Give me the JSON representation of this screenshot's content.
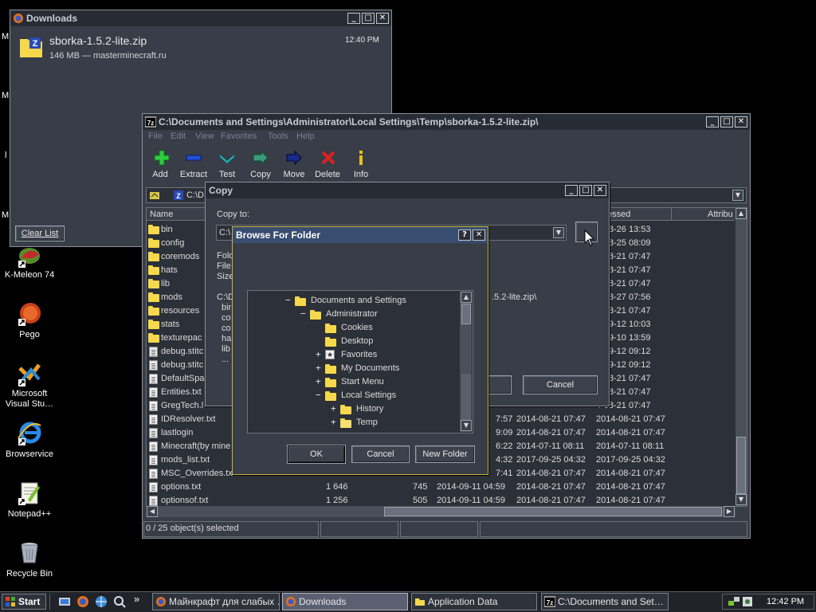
{
  "desktop": {
    "icons": [
      {
        "label": "K-Meleon 74",
        "icon": "k-meleon-icon"
      },
      {
        "label": "Pego",
        "icon": "pego-icon"
      },
      {
        "label": "Microsoft Visual Stu…",
        "icon": "visual-studio-icon"
      },
      {
        "label": "Browservice",
        "icon": "internet-explorer-icon"
      },
      {
        "label": "Notepad++",
        "icon": "notepad-plus-plus-icon"
      },
      {
        "label": "Recycle Bin",
        "icon": "recycle-bin-icon"
      }
    ],
    "partial_labels": [
      "M",
      "M",
      "l",
      "M"
    ]
  },
  "downloads": {
    "title": "Downloads",
    "item": {
      "name": "sborka-1.5.2-lite.zip",
      "info": "146 MB — masterminecraft.ru",
      "time": "12:40 PM"
    },
    "clear_list": "Clear List"
  },
  "sevenzip": {
    "title": "C:\\Documents and Settings\\Administrator\\Local Settings\\Temp\\sborka-1.5.2-lite.zip\\",
    "menu": [
      "File",
      "Edit",
      "View",
      "Favorites",
      "Tools",
      "Help"
    ],
    "toolbar": [
      {
        "label": "Add",
        "icon": "add-plus-icon",
        "color": "#2ecc40"
      },
      {
        "label": "Extract",
        "icon": "extract-minus-icon",
        "color": "#2050d8"
      },
      {
        "label": "Test",
        "icon": "test-check-icon",
        "color": "#38c8d0"
      },
      {
        "label": "Copy",
        "icon": "copy-arrow-icon",
        "color": "#3a9a7a"
      },
      {
        "label": "Move",
        "icon": "move-arrow-icon",
        "color": "#1a2a8a"
      },
      {
        "label": "Delete",
        "icon": "delete-x-icon",
        "color": "#e02020"
      },
      {
        "label": "Info",
        "icon": "info-icon",
        "color": "#e8c020"
      }
    ],
    "address": "C:\\D",
    "columns": {
      "name": "Name",
      "accessed": "essed",
      "attributes": "Attribu"
    },
    "rows": [
      {
        "name": "bin",
        "type": "folder",
        "size": "",
        "packed": "",
        "modified": "",
        "created": "",
        "accessed": "4-08-26 13:53"
      },
      {
        "name": "config",
        "type": "folder",
        "size": "",
        "packed": "",
        "modified": "",
        "created": "",
        "accessed": "4-08-25 08:09"
      },
      {
        "name": "coremods",
        "type": "folder",
        "size": "",
        "packed": "",
        "modified": "",
        "created": "",
        "accessed": "4-08-21 07:47"
      },
      {
        "name": "hats",
        "type": "folder",
        "size": "",
        "packed": "",
        "modified": "",
        "created": "",
        "accessed": "4-08-21 07:47"
      },
      {
        "name": "lib",
        "type": "folder",
        "size": "",
        "packed": "",
        "modified": "",
        "created": "",
        "accessed": "4-08-21 07:47"
      },
      {
        "name": "mods",
        "type": "folder",
        "size": "",
        "packed": "",
        "modified": "",
        "created": "",
        "accessed": "4-08-27 07:56"
      },
      {
        "name": "resources",
        "type": "folder",
        "size": "",
        "packed": "",
        "modified": "",
        "created": "",
        "accessed": "4-08-21 07:47"
      },
      {
        "name": "stats",
        "type": "folder",
        "size": "",
        "packed": "",
        "modified": "",
        "created": "",
        "accessed": "4-09-12 10:03"
      },
      {
        "name": "texturepac",
        "type": "folder",
        "size": "",
        "packed": "",
        "modified": "",
        "created": "",
        "accessed": "4-09-10 13:59"
      },
      {
        "name": "debug.stitc",
        "type": "image",
        "size": "",
        "packed": "",
        "modified": "",
        "created": "",
        "accessed": "4-09-12 09:12"
      },
      {
        "name": "debug.stitc",
        "type": "image",
        "size": "",
        "packed": "",
        "modified": "",
        "created": "",
        "accessed": "4-09-12 09:12"
      },
      {
        "name": "DefaultSpa",
        "type": "file",
        "size": "",
        "packed": "",
        "modified": "",
        "created": "",
        "accessed": "4-08-21 07:47"
      },
      {
        "name": "Entities.txt",
        "type": "file",
        "size": "",
        "packed": "",
        "modified": "",
        "created": "",
        "accessed": "4-08-21 07:47"
      },
      {
        "name": "GregTech.l",
        "type": "file",
        "size": "",
        "packed": "",
        "modified": "",
        "created": "",
        "accessed": "4-08-21 07:47"
      },
      {
        "name": "IDResolver.txt",
        "type": "file",
        "size": "",
        "packed": "",
        "modified": "7:57",
        "created": "2014-08-21 07:47",
        "accessed": "2014-08-21 07:47"
      },
      {
        "name": "lastlogin",
        "type": "image",
        "size": "",
        "packed": "",
        "modified": "9:09",
        "created": "2014-08-21 07:47",
        "accessed": "2014-08-21 07:47"
      },
      {
        "name": "Minecraft(by mine",
        "type": "file",
        "size": "",
        "packed": "",
        "modified": "6:22",
        "created": "2014-07-11 08:11",
        "accessed": "2014-07-11 08:11"
      },
      {
        "name": "mods_list.txt",
        "type": "file",
        "size": "",
        "packed": "",
        "modified": "4:32",
        "created": "2017-09-25 04:32",
        "accessed": "2017-09-25 04:32"
      },
      {
        "name": "MSC_Overrides.txt",
        "type": "file",
        "size": "",
        "packed": "",
        "modified": "7:41",
        "created": "2014-08-21 07:47",
        "accessed": "2014-08-21 07:47"
      },
      {
        "name": "options.txt",
        "type": "file",
        "size": "1 646",
        "packed": "745",
        "modified": "2014-09-11 04:59",
        "created": "2014-08-21 07:47",
        "accessed": "2014-08-21 07:47"
      },
      {
        "name": "optionsof.txt",
        "type": "file",
        "size": "1 256",
        "packed": "505",
        "modified": "2014-09-11 04:59",
        "created": "2014-08-21 07:47",
        "accessed": "2014-08-21 07:47"
      }
    ],
    "status": "0 / 25 object(s) selected"
  },
  "copy_dialog": {
    "title": "Copy",
    "copy_to_label": "Copy to:",
    "path_value": "C:\\",
    "labels": [
      "Fold",
      "File",
      "Size"
    ],
    "list_head": "C:\\D",
    "list_tail": ".5.2-lite.zip\\",
    "list_items": [
      "bir",
      "co",
      "co",
      "ha",
      "lib",
      "..."
    ],
    "cancel": "Cancel"
  },
  "browse": {
    "title": "Browse For Folder",
    "help": "?",
    "tree": [
      {
        "label": "Documents and Settings",
        "expander": "−",
        "level": 0,
        "icon": "folder"
      },
      {
        "label": "Administrator",
        "expander": "−",
        "level": 1,
        "icon": "folder"
      },
      {
        "label": "Cookies",
        "expander": "",
        "level": 2,
        "icon": "folder"
      },
      {
        "label": "Desktop",
        "expander": "",
        "level": 2,
        "icon": "folder"
      },
      {
        "label": "Favorites",
        "expander": "+",
        "level": 2,
        "icon": "favorites"
      },
      {
        "label": "My Documents",
        "expander": "+",
        "level": 2,
        "icon": "folder"
      },
      {
        "label": "Start Menu",
        "expander": "+",
        "level": 2,
        "icon": "folder"
      },
      {
        "label": "Local Settings",
        "expander": "−",
        "level": 2,
        "icon": "folder"
      },
      {
        "label": "History",
        "expander": "+",
        "level": 3,
        "icon": "history"
      },
      {
        "label": "Temp",
        "expander": "+",
        "level": 3,
        "icon": "folder-open"
      }
    ],
    "ok": "OK",
    "cancel": "Cancel",
    "new_folder": "New Folder"
  },
  "taskbar": {
    "start": "Start",
    "quick_launch": [
      "show-desktop-icon",
      "firefox-icon",
      "network-icon",
      "search-icon"
    ],
    "overflow": "»",
    "tasks": [
      {
        "label": "Майнкрафт для слабых …",
        "icon": "firefox-icon",
        "active": false
      },
      {
        "label": "Downloads",
        "icon": "firefox-icon",
        "active": true
      },
      {
        "label": "Application Data",
        "icon": "folder-icon",
        "active": false
      },
      {
        "label": "C:\\Documents and Set…",
        "icon": "7zip-icon",
        "active": false
      }
    ],
    "clock": "12:42 PM"
  },
  "colors": {
    "desktop": "#000000",
    "window": "#383d47",
    "title_active": "#384d70",
    "dialog_border": "#c8b440",
    "folder": "#f5d84b"
  }
}
